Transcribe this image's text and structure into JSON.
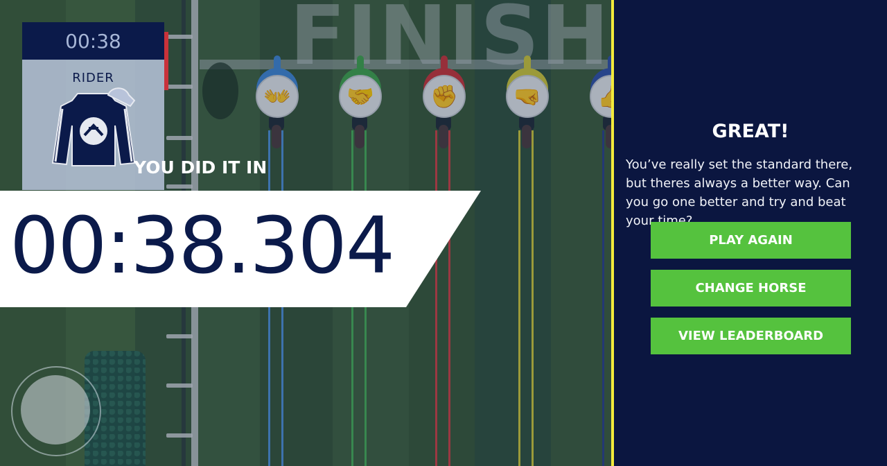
{
  "game": {
    "finish_sign": "FINISH",
    "lanes": [
      {
        "color": "#3f86d6",
        "rope": "#4d8fd9",
        "icon_name": "hands-icon",
        "glyph": "👐"
      },
      {
        "color": "#3fa34c",
        "rope": "#46ad56",
        "icon_name": "heart-handshake-icon",
        "glyph": "🤝"
      },
      {
        "color": "#c9323a",
        "rope": "#cf3f45",
        "icon_name": "fist-icon",
        "glyph": "✊"
      },
      {
        "color": "#cfc63a",
        "rope": "#cfc63a",
        "icon_name": "clasped-hands-icon",
        "glyph": "🤜"
      },
      {
        "color": "#2f4fa8",
        "rope": "#2a3f8a",
        "icon_name": "thumbs-up-icon",
        "glyph": "👍"
      }
    ]
  },
  "rider_card": {
    "timer": "00:38",
    "label": "RIDER",
    "icon": "jockey-silks-icon"
  },
  "result": {
    "intro": "YOU DID IT IN",
    "time": "00:38.304"
  },
  "panel": {
    "heading": "GREAT!",
    "message": "You’ve really set the standard there, but theres always a better way. Can you go one better and try and beat your time?",
    "buttons": {
      "play_again": "PLAY AGAIN",
      "change_horse": "CHANGE HORSE",
      "view_leaderboard": "VIEW LEADERBOARD"
    },
    "button_color": "#55c23e",
    "background": "#0b1640",
    "divider_color": "#f3ea3b"
  }
}
